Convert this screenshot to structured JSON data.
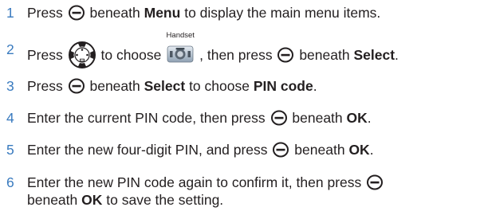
{
  "steps": [
    {
      "num": "1",
      "t1": "Press",
      "t2": "beneath",
      "b1": "Menu",
      "t3": "to display the main menu items."
    },
    {
      "num": "2",
      "t1": "Press",
      "t2": "to choose",
      "t3": ", then press",
      "t4": "beneath",
      "b1": "Select",
      "t5": ".",
      "icon_label": "Handset"
    },
    {
      "num": "3",
      "t1": "Press",
      "t2": "beneath",
      "b1": "Select",
      "t3": "to choose",
      "b2": "PIN code",
      "t4": "."
    },
    {
      "num": "4",
      "t1": "Enter the current PIN code, then press",
      "t2": "beneath",
      "b1": "OK",
      "t3": "."
    },
    {
      "num": "5",
      "t1": "Enter the new four-digit PIN, and press",
      "t2": "beneath",
      "b1": "OK",
      "t3": "."
    },
    {
      "num": "6",
      "t1": "Enter the new PIN code again to confirm it, then press",
      "t2": "beneath",
      "b1": "OK",
      "t3": "to save the setting."
    }
  ],
  "icons": {
    "soft_key": "soft-key-icon",
    "nav_key": "navigation-key-icon",
    "handset": "handset-menu-icon"
  },
  "colors": {
    "step_number": "#3a7bbf",
    "text": "#231f20"
  }
}
